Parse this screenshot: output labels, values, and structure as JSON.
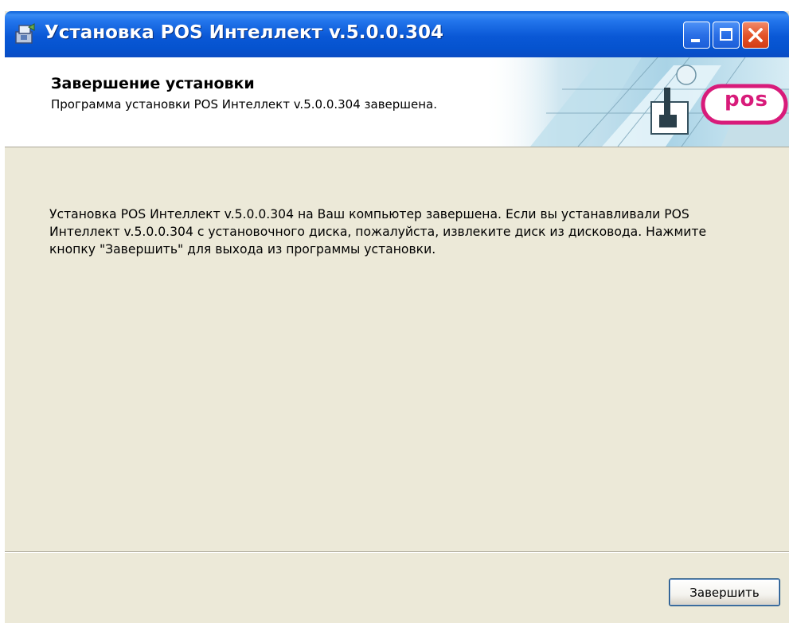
{
  "window": {
    "title": "Установка POS Интеллект v.5.0.0.304",
    "icon": "installer-icon",
    "controls": {
      "minimize": "minimize-icon",
      "maximize": "maximize-icon",
      "close": "close-icon"
    }
  },
  "banner": {
    "title": "Завершение установки",
    "subtitle": "Программа установки POS Интеллект v.5.0.0.304 завершена.",
    "logo_text": "pos",
    "logo_color": "#d81b7a"
  },
  "body": {
    "message": "Установка POS Интеллект v.5.0.0.304 на Ваш компьютер завершена. Если вы устанавливали POS Интеллект v.5.0.0.304 с установочного диска, пожалуйста, извлеките диск из дисковода. Нажмите кнопку \"Завершить\" для выхода из программы установки."
  },
  "footer": {
    "finish_label": "Завершить"
  },
  "colors": {
    "titlebar": "#0a58d6",
    "dialog_bg": "#ece9d8",
    "close_button": "#d23c14"
  }
}
